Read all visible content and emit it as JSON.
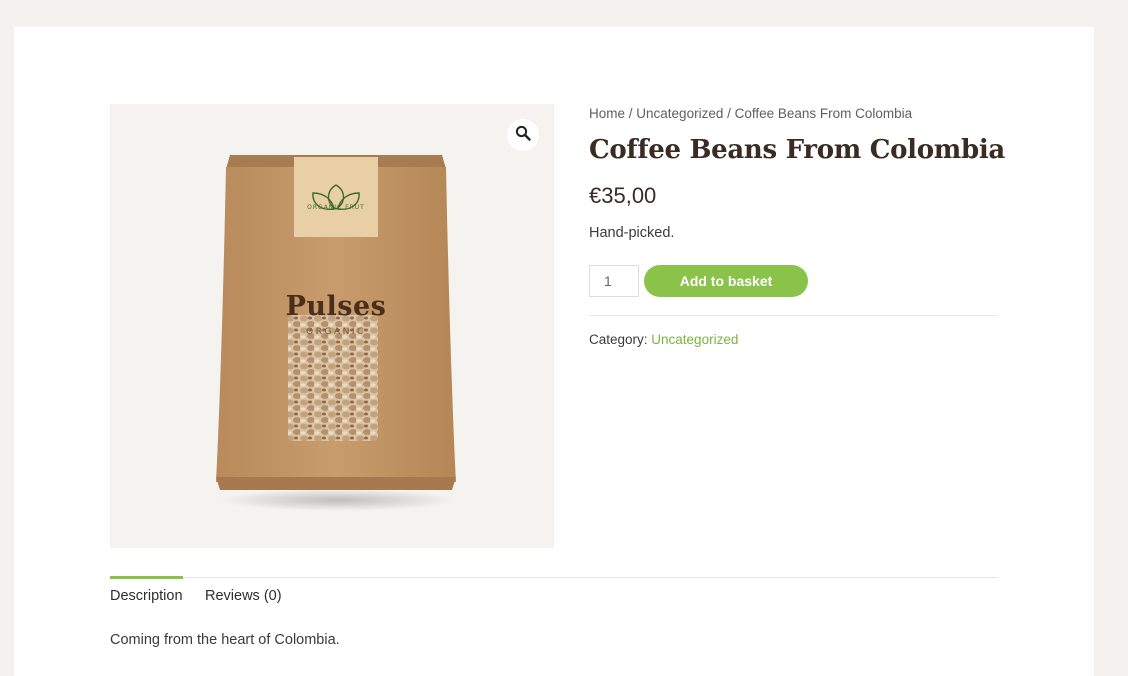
{
  "breadcrumb": {
    "home": "Home",
    "sep1": " / ",
    "category": "Uncategorized",
    "sep2": " / ",
    "current": "Coffee Beans From Colombia"
  },
  "product": {
    "title": "Coffee Beans From Colombia",
    "price": "€35,00",
    "short_description": "Hand-picked.",
    "image": {
      "label_brand": "ORGANIC FRUT",
      "title": "Pulses",
      "subtitle": "ORGANIC"
    }
  },
  "cart": {
    "quantity": "1",
    "add_label": "Add to basket"
  },
  "meta": {
    "category_label": "Category: ",
    "category_value": "Uncategorized"
  },
  "tabs": [
    {
      "label": "Description",
      "active": true
    },
    {
      "label": "Reviews (0)",
      "active": false
    }
  ],
  "description_text": "Coming from the heart of Colombia.",
  "icons": {
    "zoom": "magnifier-icon"
  },
  "colors": {
    "accent": "#8bc34a",
    "link_green": "#7cb342",
    "title": "#3b2c23"
  }
}
